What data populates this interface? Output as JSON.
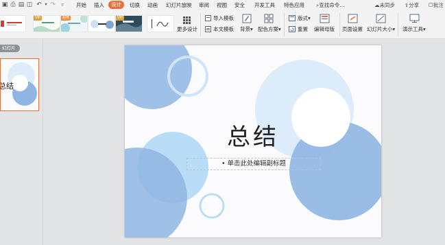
{
  "menubar": {
    "items": [
      "开始",
      "插入",
      "设计",
      "切换",
      "动画",
      "幻灯片放映",
      "审阅",
      "视图",
      "安全",
      "开发工具",
      "特色应用"
    ],
    "active_index": 2,
    "search_label": "查找命令...",
    "sync_label": "未同步",
    "share_label": "分享",
    "comment_label": "批注"
  },
  "ribbon": {
    "templates": [
      {
        "badge": ""
      },
      {
        "badge": "VIP"
      },
      {
        "badge": "稻壳"
      },
      {
        "badge": ""
      },
      {
        "badge": "VIP"
      },
      {
        "badge": ""
      }
    ],
    "more_design": "更多设计",
    "import_template": "导入模板",
    "body_template": "本文模板",
    "background": "背景",
    "color_scheme": "配色方案",
    "layout": "版式",
    "reset": "重置",
    "edit_master": "编辑母版",
    "page_setup": "页面设置",
    "slide_size": "幻灯片大小",
    "presenter_tools": "演示工具"
  },
  "left_panel": {
    "tab_label": "幻灯片",
    "thumbnail_text": "总结"
  },
  "slide": {
    "title": "总结",
    "subtitle": "• 单击此处编辑副标题"
  },
  "colors": {
    "accent": "#e8703a",
    "circle_blue": "#8fb6e3",
    "circle_light": "#b9dcf7",
    "circle_pale": "#dcecfa"
  }
}
